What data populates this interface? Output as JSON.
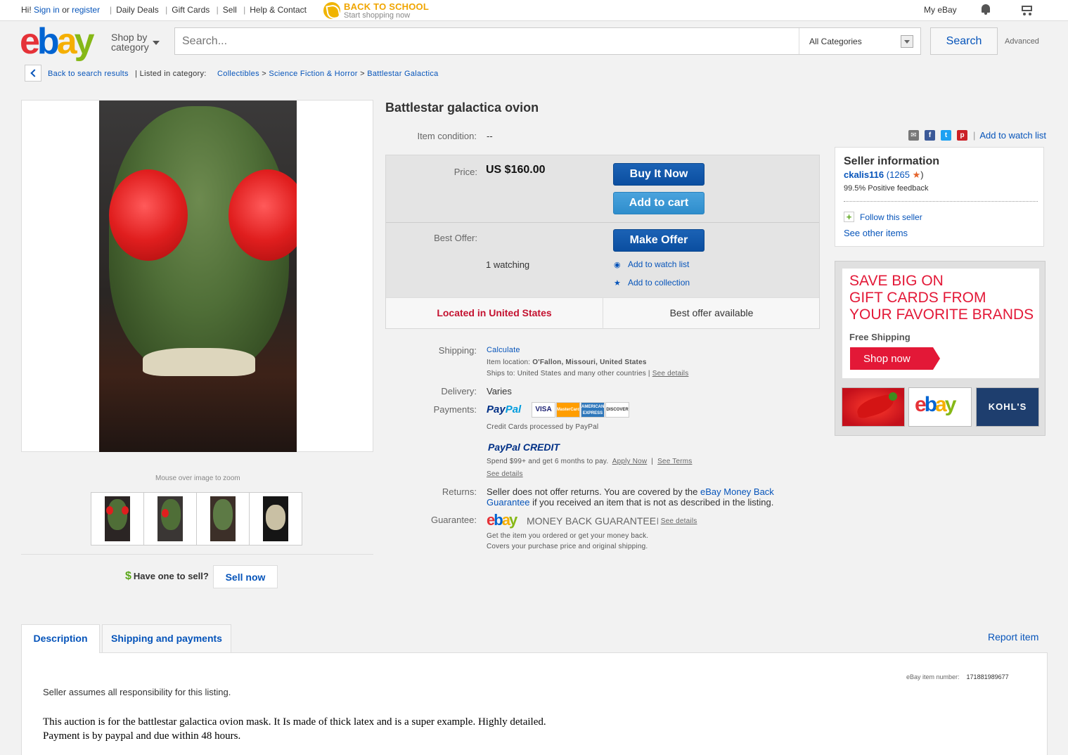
{
  "topbar": {
    "greeting": "Hi!",
    "sign_in": "Sign in",
    "or": "or",
    "register": "register",
    "links": [
      "Daily Deals",
      "Gift Cards",
      "Sell",
      "Help & Contact"
    ],
    "promo_title": "BACK TO SCHOOL",
    "promo_sub": "Start shopping now",
    "my_ebay": "My eBay",
    "icons": [
      "bell-icon",
      "cart-icon"
    ]
  },
  "header": {
    "logo": [
      "e",
      "b",
      "a",
      "y"
    ],
    "logo_colors": [
      "#e53238",
      "#0064d2",
      "#f5af02",
      "#86b817"
    ],
    "shop_by": "Shop by",
    "category": "category",
    "search_placeholder": "Search...",
    "category_select": "All Categories",
    "search_button": "Search",
    "advanced": "Advanced"
  },
  "breadcrumb": {
    "back": "Back to search results",
    "listed_in": "| Listed in category:",
    "items": [
      "Collectibles",
      "Science Fiction & Horror",
      "Battlestar Galactica"
    ],
    "separator": ">"
  },
  "gallery": {
    "zoom_hint": "Mouse over image to zoom",
    "thumbnail_count": 4,
    "have_one": "Have one to sell?",
    "sell_now": "Sell now"
  },
  "item": {
    "title": "Battlestar galactica ovion",
    "condition_label": "Item condition:",
    "condition_value": "--",
    "add_watch": "Add to watch list",
    "price_label": "Price:",
    "price": "US $160.00",
    "buy_now": "Buy It Now",
    "add_to_cart": "Add to cart",
    "best_offer_label": "Best Offer:",
    "make_offer": "Make Offer",
    "watching": "1 watching",
    "add_watch_small": "Add to watch list",
    "add_collection": "Add to collection",
    "located": "Located in United States",
    "best_offer_available": "Best offer available"
  },
  "details": {
    "shipping_label": "Shipping:",
    "calculate": "Calculate",
    "item_location_label": "Item location:",
    "item_location": "O'Fallon, Missouri, United States",
    "ships_to_label": "Ships to:",
    "ships_to": "United States and many other countries |",
    "see_details": "See details",
    "delivery_label": "Delivery:",
    "delivery": "Varies",
    "payments_label": "Payments:",
    "paypal_a": "Pay",
    "paypal_b": "Pal",
    "cards": [
      "VISA",
      "MasterCard",
      "AMERICAN EXPRESS",
      "DISCOVER"
    ],
    "processed": "Credit Cards processed by PayPal",
    "pp_credit_a": "PayPal",
    "pp_credit_b": "CREDIT",
    "spend": "Spend $99+ and get 6 months to pay.",
    "apply_now": "Apply Now",
    "see_terms": "See Terms",
    "see_details2": "See details",
    "returns_label": "Returns:",
    "returns_a": "Seller does not offer returns. You are covered by the",
    "returns_link": "eBay Money Back Guarantee",
    "returns_b": "if you received an item that is not as described in the listing.",
    "guarantee_label": "Guarantee:",
    "mbg": "MONEY BACK GUARANTEE",
    "see_details3": "See details",
    "guarantee_line1": "Get the item you ordered or get your money back.",
    "guarantee_line2": "Covers your purchase price and original shipping."
  },
  "seller": {
    "heading": "Seller information",
    "username": "ckalis116",
    "feedback_count": "(1265",
    "close_paren": ")",
    "positive": "99.5% Positive feedback",
    "follow": "Follow this seller",
    "see_other": "See other items"
  },
  "ad": {
    "line1": "SAVE BIG ON",
    "line2": "GIFT CARDS FROM",
    "line3": "YOUR FAVORITE BRANDS",
    "free_shipping": "Free Shipping",
    "shop_now": "Shop now",
    "card3": "KOHL'S"
  },
  "tabs": [
    "Description",
    "Shipping and payments"
  ],
  "report_item": "Report item",
  "description": {
    "item_number_label": "eBay item number:",
    "item_number": "171881989677",
    "responsibility": "Seller assumes all responsibility for this listing.",
    "line1": "This auction is for the battlestar galactica ovion mask. It Is made of thick latex and is a super example. Highly detailed.",
    "line2": "Payment is by paypal and due within 48 hours."
  },
  "colors": {
    "link": "#0654ba",
    "buy_blue": "#0b4ea0",
    "cart_blue": "#2e8dcc",
    "located_red": "#c41230",
    "ad_red": "#e31837"
  }
}
